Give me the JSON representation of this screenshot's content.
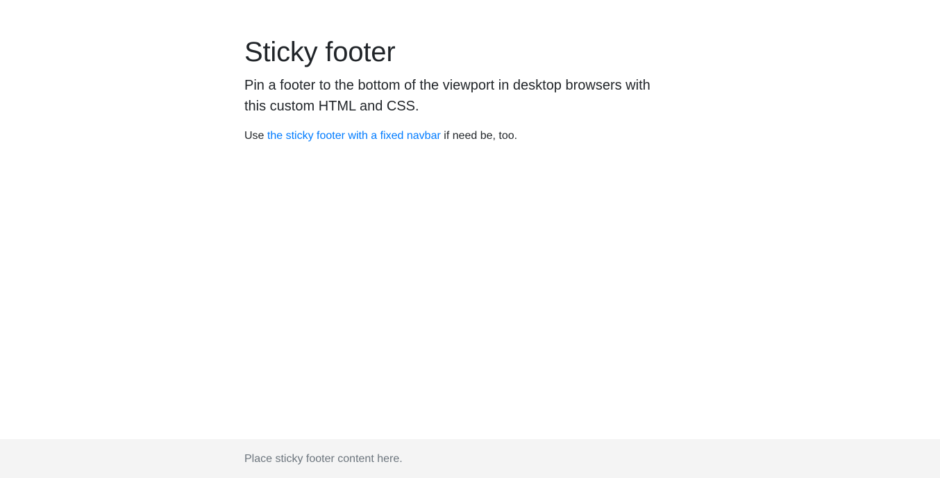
{
  "main": {
    "title": "Sticky footer",
    "lead": "Pin a footer to the bottom of the viewport in desktop browsers with this custom HTML and CSS.",
    "text_before_link": "Use ",
    "link_text": "the sticky footer with a fixed navbar",
    "text_after_link": " if need be, too."
  },
  "footer": {
    "text": "Place sticky footer content here."
  },
  "colors": {
    "link": "#007bff",
    "text": "#212529",
    "muted": "#6c757d",
    "footer_bg": "#f4f4f4"
  }
}
